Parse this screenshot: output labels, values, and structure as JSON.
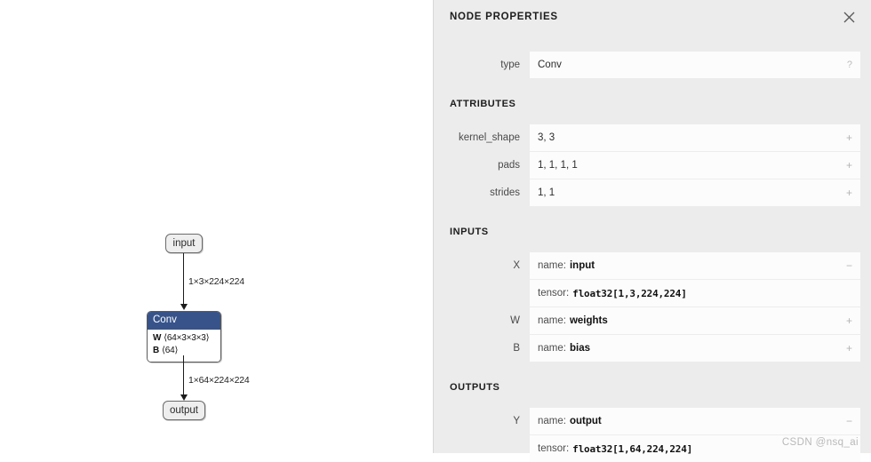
{
  "graph": {
    "input_node": {
      "label": "input"
    },
    "output_node": {
      "label": "output"
    },
    "conv_node": {
      "title": "Conv",
      "params": [
        {
          "key": "W",
          "dims": "⟨64×3×3×3⟩"
        },
        {
          "key": "B",
          "dims": "⟨64⟩"
        }
      ]
    },
    "edges": [
      {
        "label": "1×3×224×224"
      },
      {
        "label": "1×64×224×224"
      }
    ]
  },
  "sidebar": {
    "title": "NODE PROPERTIES",
    "close_label": "close",
    "type_row": {
      "name": "type",
      "value": "Conv",
      "action": "?"
    },
    "sections": [
      {
        "title": "ATTRIBUTES",
        "rows": [
          {
            "name": "kernel_shape",
            "value": "3, 3",
            "action": "+"
          },
          {
            "name": "pads",
            "value": "1, 1, 1, 1",
            "action": "+"
          },
          {
            "name": "strides",
            "value": "1, 1",
            "action": "+"
          }
        ]
      },
      {
        "title": "INPUTS",
        "rows": [
          {
            "name": "X",
            "name_label": "name:",
            "value": "input",
            "tensor_label": "tensor:",
            "tensor": "float32[1,3,224,224]",
            "action": "−"
          },
          {
            "name": "W",
            "name_label": "name:",
            "value": "weights",
            "action": "+"
          },
          {
            "name": "B",
            "name_label": "name:",
            "value": "bias",
            "action": "+"
          }
        ]
      },
      {
        "title": "OUTPUTS",
        "rows": [
          {
            "name": "Y",
            "name_label": "name:",
            "value": "output",
            "tensor_label": "tensor:",
            "tensor": "float32[1,64,224,224]",
            "action": "−"
          }
        ]
      }
    ]
  },
  "watermark": {
    "text": "CSDN @nsq_ai"
  },
  "colors": {
    "panel_bg": "#ececec",
    "row_bg": "#fcfcfc",
    "conv_header": "#37538a",
    "canvas_bg": "#ffffff"
  }
}
